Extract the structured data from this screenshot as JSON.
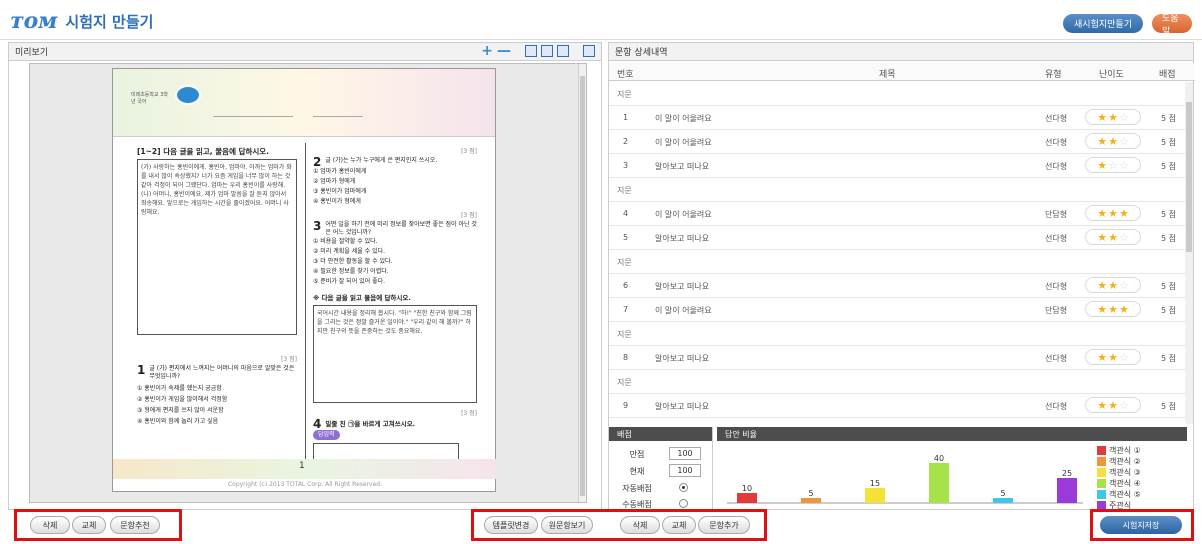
{
  "header": {
    "logo_glyph": "ᴛᴏᴍ",
    "title": "시험지 만들기",
    "new_button": "새시험지만들기",
    "help_button": "도움말"
  },
  "left": {
    "panel_title": "미리보기",
    "zoom_in": "+",
    "zoom_out": "—"
  },
  "paper": {
    "school": "미래초등학교 3학년 국어",
    "col1_heading": "[1~2] 다음 글을 읽고, 물음에 답하시오.",
    "col1_passage": "(가) 사랑하는 홍빈이에게. 홍빈아, 엄마야. 아까는 엄마가 화를 내서 많이 속상했지? 너가 요즘 게임을 너무 많이 하는 것 같아 걱정이 되어 그랬단다. 엄마는 우리 홍빈이를 사랑해. (나) 어머니, 홍빈이에요. 제가 엄마 말씀을 잘 듣지 않아서 죄송해요. 앞으로는 게임하는 시간을 줄이겠어요. 어머니 사랑해요.",
    "q1_num": "1",
    "q1_text": "글 (가) 편지에서 느껴지는 어머니의 마음으로 알맞은 것은 무엇입니까?",
    "q1_choices": [
      "① 홍빈이가 숙제를 했는지 궁금함",
      "② 홍빈이가 게임을 많이해서 걱정함",
      "③ 형에게 편지를 쓰지 않아 서운함",
      "④ 홍빈이와 함께 놀러 가고 싶음"
    ],
    "q2_num": "2",
    "q2_text": "글 (가)는 누가 누구에게 쓴 편지인지 쓰시오.",
    "q2_choices": [
      "① 엄마가 홍빈이에게",
      "② 엄마가 형에게",
      "③ 홍빈이가 엄마에게",
      "④ 홍빈이가 형에게"
    ],
    "q3_num": "3",
    "q3_text": "어떤 일을 하기 전에 미리 정보를 찾아보면 좋은 점이 아닌 것은 어느 것입니까?",
    "q3_choices": [
      "① 비용을 절약할 수 있다.",
      "② 미리 계획을 세울 수 있다.",
      "③ 더 안전한 활동을 할 수 있다.",
      "④ 필요한 정보를 찾기 어렵다.",
      "⑤ 준비가 잘 되어 있어 좋다."
    ],
    "passage2_heading": "※ 다음 글을 읽고 물음에 답하시오.",
    "passage2": "국어시간 내용을 정리해 봅시다. \"하!\" \"친한 친구와 함께 그림을 그리는 것은 정말 즐거운 일이야.\" \"우리 같이 해 볼까?\" 하지만 친구의 뜻을 존중하는 것도 중요해요.",
    "q4_num": "4",
    "q4_text": "밑줄 친 ㉠을 바르게 고쳐쓰시오.",
    "answer_chip": "답입력",
    "points_tag": "[3 점]",
    "page_no": "1",
    "copyright": "Copyright (c) 2013 TOTAL Corp. All Right Reserved."
  },
  "right": {
    "panel_title": "문항 상세내역",
    "columns": {
      "num": "번호",
      "title": "제목",
      "type": "유형",
      "difficulty": "난이도",
      "score": "배점"
    },
    "jimun_label": "지문",
    "rows": [
      {
        "kind": "jimun"
      },
      {
        "kind": "item",
        "num": "1",
        "title": "이 말이 어울려요",
        "type": "선다형",
        "stars": 2,
        "score": "5 점"
      },
      {
        "kind": "item",
        "num": "2",
        "title": "이 말이 어울려요",
        "type": "선다형",
        "stars": 2,
        "score": "5 점"
      },
      {
        "kind": "item",
        "num": "3",
        "title": "알아보고 떠나요",
        "type": "선다형",
        "stars": 1,
        "score": "5 점"
      },
      {
        "kind": "jimun"
      },
      {
        "kind": "item",
        "num": "4",
        "title": "이 말이 어울려요",
        "type": "단답형",
        "stars": 3,
        "score": "5 점"
      },
      {
        "kind": "item",
        "num": "5",
        "title": "알아보고 떠나요",
        "type": "선다형",
        "stars": 2,
        "score": "5 점"
      },
      {
        "kind": "jimun"
      },
      {
        "kind": "item",
        "num": "6",
        "title": "알아보고 떠나요",
        "type": "선다형",
        "stars": 2,
        "score": "5 점"
      },
      {
        "kind": "item",
        "num": "7",
        "title": "이 말이 어울려요",
        "type": "단답형",
        "stars": 3,
        "score": "5 점"
      },
      {
        "kind": "jimun"
      },
      {
        "kind": "item",
        "num": "8",
        "title": "알아보고 떠나요",
        "type": "선다형",
        "stars": 2,
        "score": "5 점"
      },
      {
        "kind": "jimun"
      },
      {
        "kind": "item",
        "num": "9",
        "title": "알아보고 떠나요",
        "type": "선다형",
        "stars": 2,
        "score": "5 점"
      },
      {
        "kind": "jimun"
      }
    ],
    "score": {
      "title": "배점",
      "full_label": "만점",
      "full_value": "100",
      "current_label": "현재",
      "current_value": "100",
      "auto_label": "자동배점",
      "auto_checked": true,
      "manual_label": "수동배점",
      "manual_checked": false
    },
    "ratio_title": "답안 비율"
  },
  "chart_data": {
    "type": "bar",
    "title": "답안 비율",
    "categories": [
      "객관식 ①",
      "객관식 ②",
      "객관식 ③",
      "객관식 ④",
      "객관식 ⑤",
      "주관식"
    ],
    "values": [
      10,
      5,
      15,
      40,
      5,
      25
    ],
    "colors": [
      "#e23a3a",
      "#f0953a",
      "#f2e23a",
      "#a6e34a",
      "#3ec8e8",
      "#9a3ad8"
    ],
    "ylim": [
      0,
      50
    ],
    "legend": "right"
  },
  "buttons": {
    "delete_left": "삭제",
    "replace_left": "교체",
    "recommend": "문항추천",
    "template_change": "템플릿변경",
    "view_original": "원문항보기",
    "delete_right": "삭제",
    "replace_right": "교체",
    "add_item": "문항추가",
    "save": "시험지저장"
  },
  "colors": {
    "accent_blue": "#2f6aa8",
    "help_orange": "#d9642f",
    "highlight_red": "#e01010",
    "star_yellow": "#f3b21c"
  }
}
